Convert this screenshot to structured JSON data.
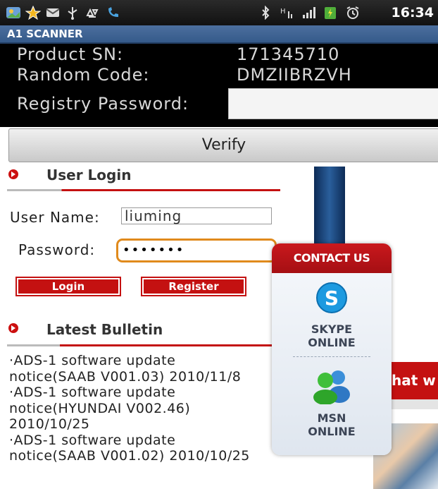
{
  "status_bar": {
    "time": "16:34",
    "icons": [
      "gallery-icon",
      "star-icon",
      "mail-icon",
      "usb-icon",
      "recycle-icon",
      "phone-icon",
      "bluetooth-icon",
      "network-h-icon",
      "signal-icon",
      "battery-icon",
      "alarm-icon"
    ]
  },
  "app": {
    "title": "A1 SCANNER"
  },
  "device": {
    "product_sn_label": "Product SN:",
    "product_sn_value": "171345710",
    "random_code_label": "Random Code:",
    "random_code_value": "DMZIIBRZVH",
    "registry_password_label": "Registry Password:",
    "registry_password_value": ""
  },
  "verify_label": "Verify",
  "login": {
    "title": "User Login",
    "username_label": "User Name:",
    "username_value": "liuming",
    "password_label": "Password:",
    "password_value": "•••••••",
    "login_button": "Login",
    "register_button": "Register"
  },
  "bulletin": {
    "title": "Latest Bulletin",
    "items": [
      "·ADS-1 software update notice(SAAB V001.03) 2010/11/8",
      "·ADS-1 software update notice(HYUNDAI V002.46) 2010/10/25",
      "·ADS-1 software update notice(SAAB V001.02) 2010/10/25"
    ]
  },
  "contact": {
    "title": "CONTACT US",
    "skype_line1": "SKYPE",
    "skype_line2": "ONLINE",
    "msn_line1": "MSN",
    "msn_line2": "ONLINE"
  },
  "banner_text": "hat w",
  "colors": {
    "accent_red": "#c41111",
    "title_blue": "#3d6293",
    "focus_orange": "#e08a1c"
  }
}
